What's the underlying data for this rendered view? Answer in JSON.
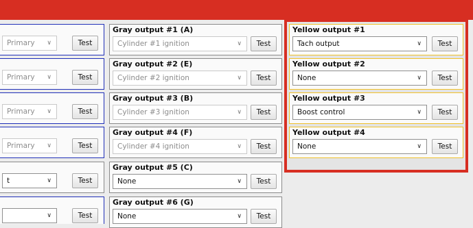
{
  "left_column": {
    "rows": [
      {
        "select": "Primary",
        "disabled": true,
        "button": "Test"
      },
      {
        "select": "Primary",
        "disabled": true,
        "button": "Test"
      },
      {
        "select": "Primary",
        "disabled": true,
        "button": "Test"
      },
      {
        "select": "Primary",
        "disabled": true,
        "button": "Test"
      },
      {
        "select": "t",
        "disabled": false,
        "button": "Test"
      },
      {
        "select": "",
        "disabled": false,
        "button": "Test"
      }
    ]
  },
  "gray_outputs": [
    {
      "title": "Gray output #1 (A)",
      "select": "Cylinder #1 ignition",
      "disabled": true,
      "button": "Test"
    },
    {
      "title": "Gray output #2 (E)",
      "select": "Cylinder #2 ignition",
      "disabled": true,
      "button": "Test"
    },
    {
      "title": "Gray output #3 (B)",
      "select": "Cylinder #3 ignition",
      "disabled": true,
      "button": "Test"
    },
    {
      "title": "Gray output #4 (F)",
      "select": "Cylinder #4 ignition",
      "disabled": true,
      "button": "Test"
    },
    {
      "title": "Gray output #5 (C)",
      "select": "None",
      "disabled": false,
      "button": "Test"
    },
    {
      "title": "Gray output #6 (G)",
      "select": "None",
      "disabled": false,
      "button": "Test"
    }
  ],
  "yellow_outputs": [
    {
      "title": "Yellow output #1",
      "select": "Tach output",
      "button": "Test"
    },
    {
      "title": "Yellow output #2",
      "select": "None",
      "button": "Test"
    },
    {
      "title": "Yellow output #3",
      "select": "Boost control",
      "button": "Test"
    },
    {
      "title": "Yellow output #4",
      "select": "None",
      "button": "Test"
    }
  ],
  "icons": {
    "dropdown": "chevron-down-icon"
  },
  "colors": {
    "highlight_red": "#d72e22",
    "blue_border": "#1f2fb8",
    "yellow_border": "#f0c12a"
  }
}
